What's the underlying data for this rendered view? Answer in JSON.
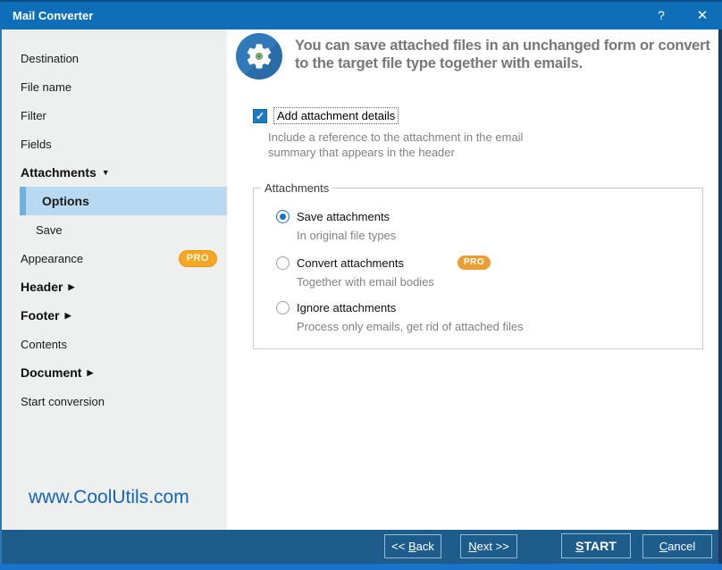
{
  "titlebar": {
    "title": "Mail Converter",
    "help": "?",
    "close": "✕"
  },
  "icons": {
    "arrow_down": "▼",
    "arrow_right": "▶",
    "check": "✓"
  },
  "sidebar": {
    "items": [
      {
        "label": "Destination"
      },
      {
        "label": "File name"
      },
      {
        "label": "Filter"
      },
      {
        "label": "Fields"
      },
      {
        "label": "Attachments"
      },
      {
        "label": "Options"
      },
      {
        "label": "Save"
      },
      {
        "label": "Appearance",
        "badge": "PRO"
      },
      {
        "label": "Header"
      },
      {
        "label": "Footer"
      },
      {
        "label": "Contents"
      },
      {
        "label": "Document"
      },
      {
        "label": "Start conversion"
      }
    ],
    "website": "www.CoolUtils.com"
  },
  "hero": {
    "text": "You can save attached files in an unchanged form or convert to the target file type together with emails."
  },
  "attachment_details": {
    "label": "Add attachment details",
    "checked": true,
    "description": "Include a reference to the attachment in the email summary that appears in the header"
  },
  "attachments_group": {
    "title": "Attachments",
    "options": [
      {
        "label": "Save attachments",
        "description": "In original file types",
        "selected": true
      },
      {
        "label": "Convert attachments",
        "description": "Together with email bodies",
        "badge": "PRO",
        "selected": false
      },
      {
        "label": "Ignore attachments",
        "description": "Process only emails, get rid of attached files",
        "selected": false
      }
    ]
  },
  "footer_buttons": {
    "back": {
      "pre": "<< ",
      "key": "B",
      "post": "ack"
    },
    "next": {
      "pre": "",
      "key": "N",
      "post": "ext >>"
    },
    "start": {
      "pre": "",
      "key": "S",
      "post": "TART"
    },
    "cancel": {
      "pre": "",
      "key": "C",
      "post": "ancel"
    }
  },
  "colors": {
    "titlebar": "#0e6fb8",
    "bottombar": "#1e5c8b",
    "selection_bg": "#b9d9f2",
    "selection_accent": "#6fb0dd",
    "pro_badge": "#f5a623",
    "link": "#1464be",
    "accent_blue": "#1374bf"
  }
}
